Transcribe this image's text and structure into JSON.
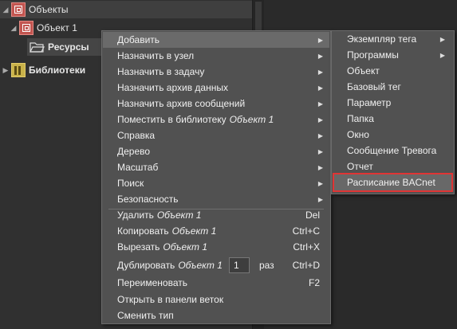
{
  "tree": {
    "items": [
      {
        "label": "Объекты",
        "arrow": "◢",
        "icon": "object-icon"
      },
      {
        "label": "Объект 1",
        "arrow": "◢",
        "icon": "object-icon"
      },
      {
        "label": "Ресурсы",
        "icon": "folder-icon"
      },
      {
        "label": "Библиотеки",
        "arrow": "▶",
        "icon": "library-icon"
      }
    ]
  },
  "menu": {
    "items": [
      {
        "label": "Добавить",
        "submenu": "▶"
      },
      {
        "label": "Назначить в узел",
        "submenu": "▶"
      },
      {
        "label": "Назначить в задачу",
        "submenu": "▶"
      },
      {
        "label": "Назначить архив данных",
        "submenu": "▶"
      },
      {
        "label": "Назначить архив сообщений",
        "submenu": "▶"
      },
      {
        "label": "Поместить в библиотеку",
        "italic": "Объект 1",
        "submenu": "▶"
      },
      {
        "label": "Справка",
        "submenu": "▶"
      },
      {
        "label": "Дерево",
        "submenu": "▶"
      },
      {
        "label": "Масштаб",
        "submenu": "▶"
      },
      {
        "label": "Поиск",
        "submenu": "▶"
      },
      {
        "label": "Безопасность",
        "submenu": "▶"
      }
    ],
    "actions": [
      {
        "label": "Удалить",
        "italic": "Объект 1",
        "shortcut": "Del"
      },
      {
        "label": "Копировать",
        "italic": "Объект 1",
        "shortcut": "Ctrl+C"
      },
      {
        "label": "Вырезать",
        "italic": "Объект 1",
        "shortcut": "Ctrl+X"
      }
    ],
    "duplicate": {
      "label": "Дублировать",
      "italic": "Объект 1",
      "count": "1",
      "suffix": "раз",
      "shortcut": "Ctrl+D"
    },
    "rename": {
      "label": "Переименовать",
      "shortcut": "F2"
    },
    "open_branch": {
      "label": "Открыть в панели веток"
    },
    "change_type": {
      "label": "Сменить тип"
    }
  },
  "submenu": {
    "items": [
      {
        "label": "Экземпляр тега",
        "submenu": "▶"
      },
      {
        "label": "Программы",
        "submenu": "▶"
      },
      {
        "label": "Объект"
      },
      {
        "label": "Базовый тег"
      },
      {
        "label": "Параметр"
      },
      {
        "label": "Папка"
      },
      {
        "label": "Окно"
      },
      {
        "label": "Сообщение Тревога"
      },
      {
        "label": "Отчет"
      },
      {
        "label": "Расписание BACnet"
      }
    ]
  },
  "colors": {
    "highlight_border": "#e03535",
    "object_icon": "#c25550",
    "library_icon": "#c9b24a"
  }
}
